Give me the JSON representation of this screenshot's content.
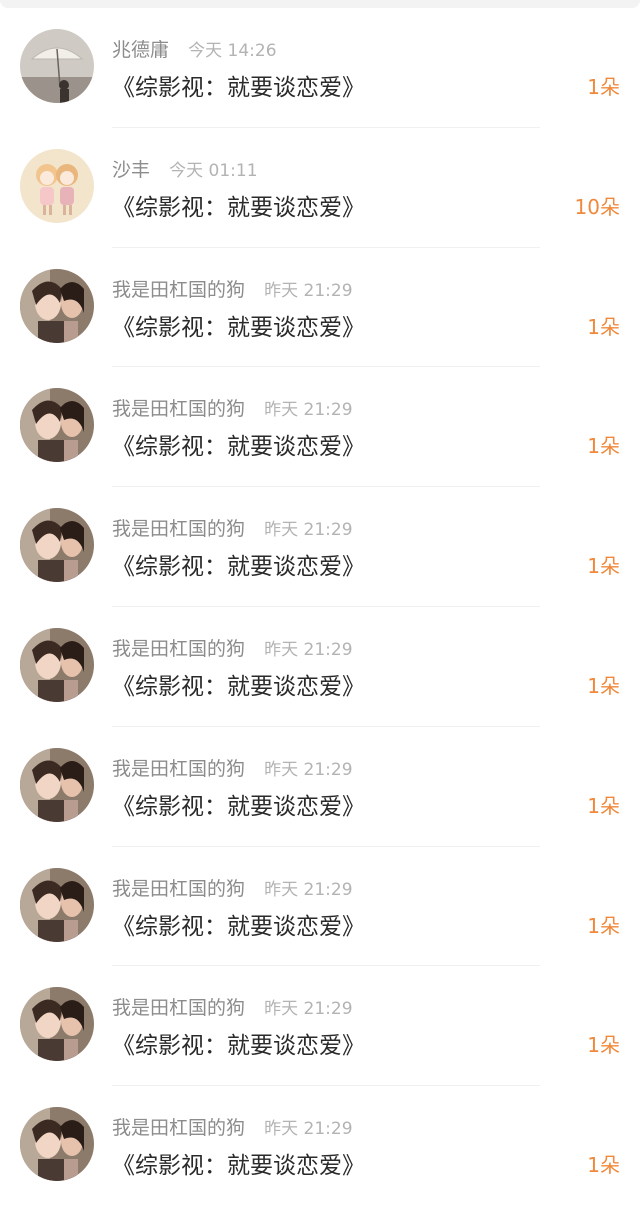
{
  "rows": [
    {
      "name": "兆德庸",
      "time": "今天 14:26",
      "title": "《综影视：就要谈恋爱》",
      "gift": "1朵",
      "avatar_icon": "umbrella-photo-avatar"
    },
    {
      "name": "沙丰",
      "time": "今天 01:11",
      "title": "《综影视：就要谈恋爱》",
      "gift": "10朵",
      "avatar_icon": "anime-girls-avatar"
    },
    {
      "name": "我是田杠国的狗",
      "time": "昨天 21:29",
      "title": "《综影视：就要谈恋爱》",
      "gift": "1朵",
      "avatar_icon": "selfie-photo-avatar"
    },
    {
      "name": "我是田杠国的狗",
      "time": "昨天 21:29",
      "title": "《综影视：就要谈恋爱》",
      "gift": "1朵",
      "avatar_icon": "selfie-photo-avatar"
    },
    {
      "name": "我是田杠国的狗",
      "time": "昨天 21:29",
      "title": "《综影视：就要谈恋爱》",
      "gift": "1朵",
      "avatar_icon": "selfie-photo-avatar"
    },
    {
      "name": "我是田杠国的狗",
      "time": "昨天 21:29",
      "title": "《综影视：就要谈恋爱》",
      "gift": "1朵",
      "avatar_icon": "selfie-photo-avatar"
    },
    {
      "name": "我是田杠国的狗",
      "time": "昨天 21:29",
      "title": "《综影视：就要谈恋爱》",
      "gift": "1朵",
      "avatar_icon": "selfie-photo-avatar"
    },
    {
      "name": "我是田杠国的狗",
      "time": "昨天 21:29",
      "title": "《综影视：就要谈恋爱》",
      "gift": "1朵",
      "avatar_icon": "selfie-photo-avatar"
    },
    {
      "name": "我是田杠国的狗",
      "time": "昨天 21:29",
      "title": "《综影视：就要谈恋爱》",
      "gift": "1朵",
      "avatar_icon": "selfie-photo-avatar"
    },
    {
      "name": "我是田杠国的狗",
      "time": "昨天 21:29",
      "title": "《综影视：就要谈恋爱》",
      "gift": "1朵",
      "avatar_icon": "selfie-photo-avatar"
    }
  ],
  "colors": {
    "gift": "#f0893c",
    "name": "#8c8c8c",
    "time": "#b3b3b3",
    "title": "#2a2a2a"
  }
}
